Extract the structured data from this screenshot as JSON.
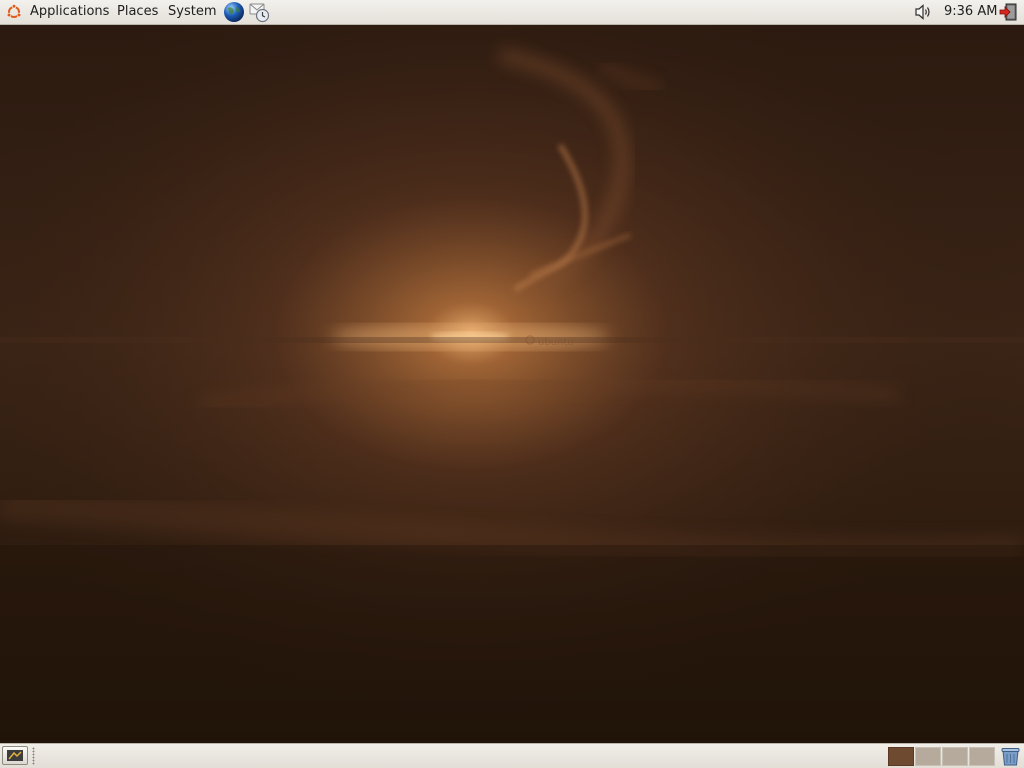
{
  "top_panel": {
    "menus": {
      "applications": "Applications",
      "places": "Places",
      "system": "System"
    },
    "launchers": [
      "firefox-icon",
      "evolution-mail-icon"
    ],
    "tray": {
      "volume_icon": "speaker-volume-icon",
      "clock": "9:36 AM",
      "logout_icon": "logout-icon"
    }
  },
  "desktop": {
    "wallpaper_logo_text": "ubuntu",
    "colors": {
      "base": "#2a1a10",
      "glow": "#e8a060"
    }
  },
  "bottom_panel": {
    "show_desktop_icon": "show-desktop-icon",
    "workspaces": [
      {
        "active": true
      },
      {
        "active": false
      },
      {
        "active": false
      },
      {
        "active": false
      }
    ],
    "trash_icon": "trash-icon"
  }
}
